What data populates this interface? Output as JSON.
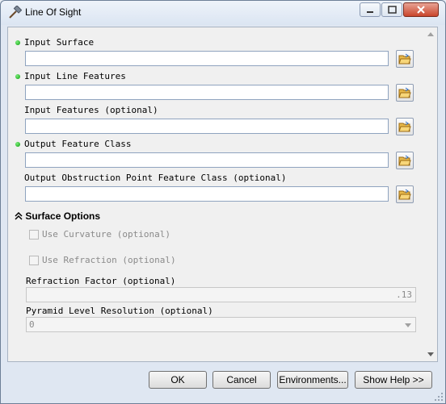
{
  "window": {
    "title": "Line Of Sight",
    "title_icon": "hammer-icon",
    "controls": [
      "minimize-icon",
      "maximize-icon",
      "close-icon"
    ]
  },
  "fields": [
    {
      "label": "Input Surface",
      "required": true,
      "value": ""
    },
    {
      "label": "Input Line Features",
      "required": true,
      "value": ""
    },
    {
      "label": "Input Features (optional)",
      "required": false,
      "value": ""
    },
    {
      "label": "Output Feature Class",
      "required": true,
      "value": ""
    },
    {
      "label": "Output Obstruction Point Feature Class (optional)",
      "required": false,
      "value": ""
    }
  ],
  "surface_options": {
    "title": "Surface Options",
    "use_curvature": {
      "label": "Use Curvature (optional)",
      "checked": false
    },
    "use_refraction": {
      "label": "Use Refraction (optional)",
      "checked": false
    },
    "refraction_factor": {
      "label": "Refraction Factor (optional)",
      "value": ".13"
    },
    "pyramid_level": {
      "label": "Pyramid Level Resolution (optional)",
      "value": "0"
    }
  },
  "buttons": {
    "ok": "OK",
    "cancel": "Cancel",
    "environments": "Environments...",
    "show_help": "Show Help >>"
  },
  "colors": {
    "required_dot": "#11b011",
    "window_frame": "#dfe7f2"
  }
}
